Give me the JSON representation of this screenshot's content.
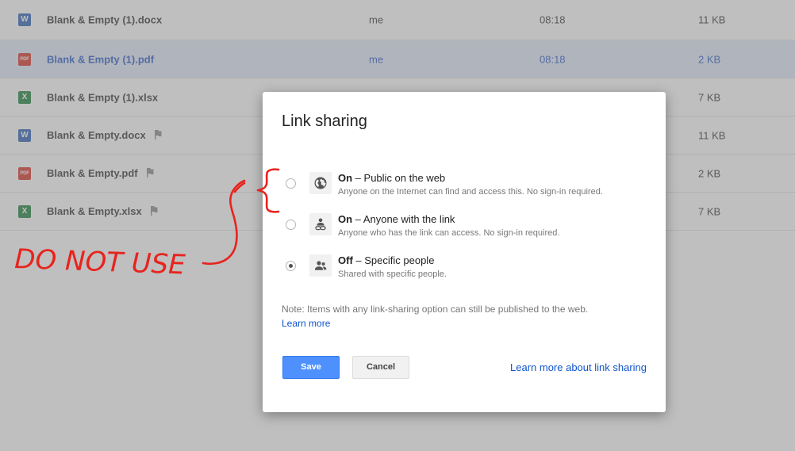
{
  "files": [
    {
      "name": "Blank & Empty (1).docx",
      "type": "word",
      "icon": "word-icon",
      "owner": "me",
      "modified": "08:18",
      "size": "11 KB",
      "flagged": false,
      "selected": false
    },
    {
      "name": "Blank & Empty (1).pdf",
      "type": "pdf",
      "icon": "pdf-icon",
      "owner": "me",
      "modified": "08:18",
      "size": "2 KB",
      "flagged": false,
      "selected": true
    },
    {
      "name": "Blank & Empty (1).xlsx",
      "type": "excel",
      "icon": "excel-icon",
      "owner": "",
      "modified": "",
      "size": "7 KB",
      "flagged": false,
      "selected": false
    },
    {
      "name": "Blank & Empty.docx",
      "type": "word",
      "icon": "word-icon",
      "owner": "",
      "modified": "",
      "size": "11 KB",
      "flagged": true,
      "selected": false
    },
    {
      "name": "Blank & Empty.pdf",
      "type": "pdf",
      "icon": "pdf-icon",
      "owner": "",
      "modified": "",
      "size": "2 KB",
      "flagged": true,
      "selected": false
    },
    {
      "name": "Blank & Empty.xlsx",
      "type": "excel",
      "icon": "excel-icon",
      "owner": "",
      "modified": "",
      "size": "7 KB",
      "flagged": true,
      "selected": false
    }
  ],
  "file_icon_glyphs": {
    "word": "W",
    "pdf": "PDF",
    "excel": "X"
  },
  "dialog": {
    "title": "Link sharing",
    "options": [
      {
        "state": "On",
        "separator": " – ",
        "label": "Public on the web",
        "description": "Anyone on the Internet can find and access this. No sign-in required.",
        "icon": "globe-icon",
        "checked": false
      },
      {
        "state": "On",
        "separator": " – ",
        "label": "Anyone with the link",
        "description": "Anyone who has the link can access. No sign-in required.",
        "icon": "person-link-icon",
        "checked": false
      },
      {
        "state": "Off",
        "separator": " – ",
        "label": "Specific people",
        "description": "Shared with specific people.",
        "icon": "people-icon",
        "checked": true
      }
    ],
    "note": "Note: Items with any link-sharing option can still be published to the web.",
    "note_link": "Learn more",
    "save_label": "Save",
    "cancel_label": "Cancel",
    "help_link": "Learn more about link sharing"
  },
  "annotation": {
    "text": "DO NOT USE",
    "color": "#e8231d"
  },
  "colors": {
    "primary_button": "#4d90fe",
    "link": "#1155cc",
    "selected_row": "#e1ebfb",
    "selected_text": "#2a56c6"
  }
}
